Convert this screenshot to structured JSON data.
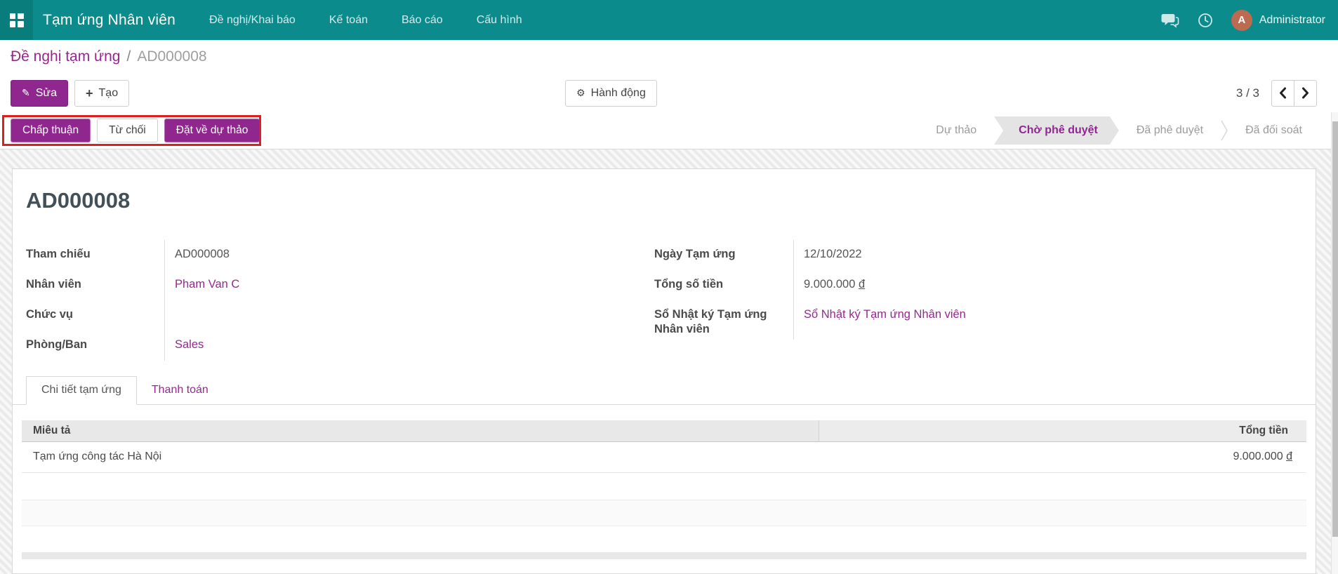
{
  "navbar": {
    "app_title": "Tạm ứng Nhân viên",
    "menus": [
      "Đề nghị/Khai báo",
      "Kế toán",
      "Báo cáo",
      "Cấu hình"
    ],
    "user_name": "Administrator",
    "avatar_initial": "A"
  },
  "icons": {
    "edit": "✎",
    "create": "+",
    "action": "⚙"
  },
  "control_panel": {
    "breadcrumb_parent": "Đề nghị tạm ứng",
    "breadcrumb_separator": "/",
    "breadcrumb_current": "AD000008",
    "edit_label": "Sửa",
    "create_label": "Tạo",
    "action_label": "Hành động",
    "pager_value": "3 / 3"
  },
  "status_actions": {
    "approve": "Chấp thuận",
    "refuse": "Từ chối",
    "set_to_draft": "Đặt về dự thảo"
  },
  "statusbar": {
    "active": "Chờ phê duyệt",
    "states": [
      {
        "label": "Dự thảo"
      },
      {
        "label": "Chờ phê duyệt"
      },
      {
        "label": "Đã phê duyệt"
      },
      {
        "label": "Đã đối soát"
      }
    ]
  },
  "form": {
    "title": "AD000008",
    "left_fields": [
      {
        "label": "Tham chiếu",
        "value": "AD000008"
      },
      {
        "label": "Nhân viên",
        "value": "Pham Van C"
      },
      {
        "label": "Chức vụ",
        "value": ""
      },
      {
        "label": "Phòng/Ban",
        "value": "Sales"
      }
    ],
    "right_fields": [
      {
        "label": "Ngày Tạm ứng",
        "value": "12/10/2022"
      },
      {
        "label": "Tổng số tiền",
        "value": "9.000.000",
        "currency": "đ"
      },
      {
        "label": "Sổ Nhật ký Tạm ứng Nhân viên",
        "value": "Sổ Nhật ký Tạm ứng Nhân viên"
      }
    ],
    "tabs": [
      {
        "label": "Chi tiết tạm ứng"
      },
      {
        "label": "Thanh toán"
      }
    ],
    "table": {
      "columns": [
        "Miêu tả",
        "Tổng tiền"
      ],
      "rows": [
        {
          "description": "Tạm ứng công tác Hà Nội",
          "amount": "9.000.000",
          "currency": "đ"
        }
      ]
    }
  },
  "colors": {
    "navbar_teal": "#0b8b8b",
    "accent_purple": "#8f278f",
    "link_purple": "#97278f",
    "annotation_red": "#dd1f1f",
    "avatar_orange": "#bc6b50"
  }
}
